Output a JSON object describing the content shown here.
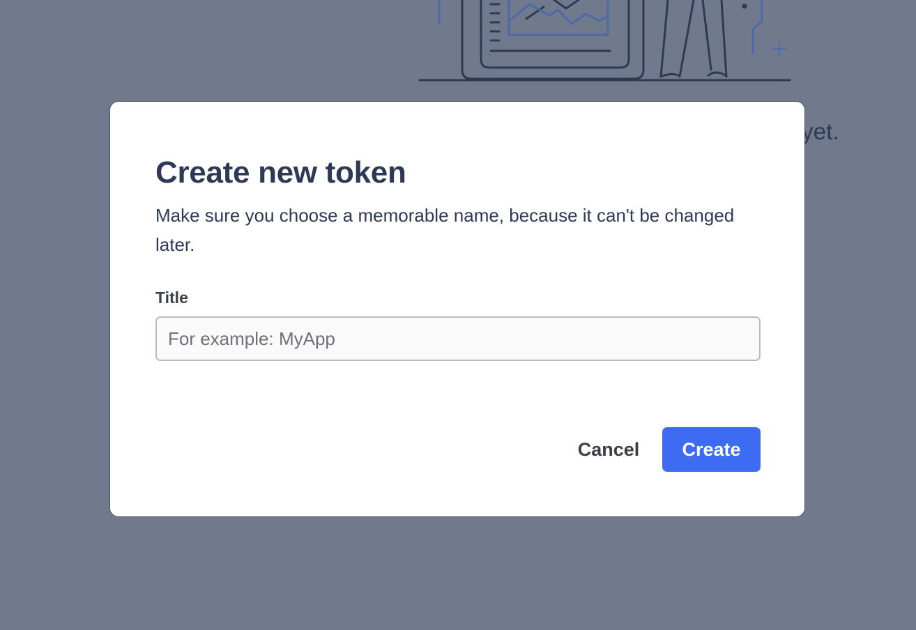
{
  "background": {
    "empty_state_text": "yet."
  },
  "dialog": {
    "title": "Create new token",
    "description": "Make sure you choose a memorable name, because it can't be changed later.",
    "field": {
      "label": "Title",
      "value": "",
      "placeholder": "For example: MyApp"
    },
    "cancel_label": "Cancel",
    "create_label": "Create"
  },
  "colors": {
    "overlay": "#717a8c",
    "primary": "#3d6cf2",
    "text": "#2e3a55"
  }
}
